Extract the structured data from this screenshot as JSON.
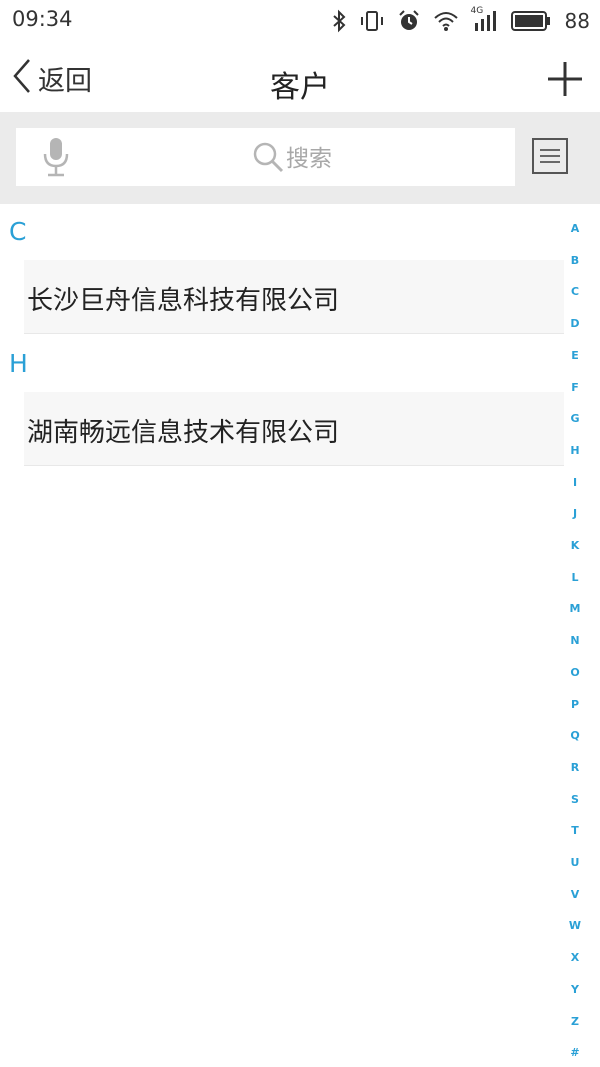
{
  "status_bar": {
    "time": "09:34",
    "network": "4G",
    "battery": "88",
    "icons": [
      "bluetooth-icon",
      "vibrate-icon",
      "alarm-icon",
      "wifi-icon",
      "signal-icon",
      "battery-icon"
    ]
  },
  "header": {
    "back_label": "返回",
    "title": "客户",
    "add_icon": "plus-icon"
  },
  "search": {
    "placeholder": "搜索",
    "mic_icon": "microphone-icon",
    "search_icon": "magnifier-icon",
    "list_icon": "list-icon"
  },
  "sections": [
    {
      "letter": "C",
      "items": [
        {
          "name": "长沙巨舟信息科技有限公司"
        }
      ]
    },
    {
      "letter": "H",
      "items": [
        {
          "name": "湖南畅远信息技术有限公司"
        }
      ]
    }
  ],
  "alphabet": [
    "A",
    "B",
    "C",
    "D",
    "E",
    "F",
    "G",
    "H",
    "I",
    "J",
    "K",
    "L",
    "M",
    "N",
    "O",
    "P",
    "Q",
    "R",
    "S",
    "T",
    "U",
    "V",
    "W",
    "X",
    "Y",
    "Z",
    "#"
  ],
  "colors": {
    "accent": "#2aa0d6",
    "search_bg": "#ebebeb",
    "row_bg": "#f7f7f7"
  }
}
